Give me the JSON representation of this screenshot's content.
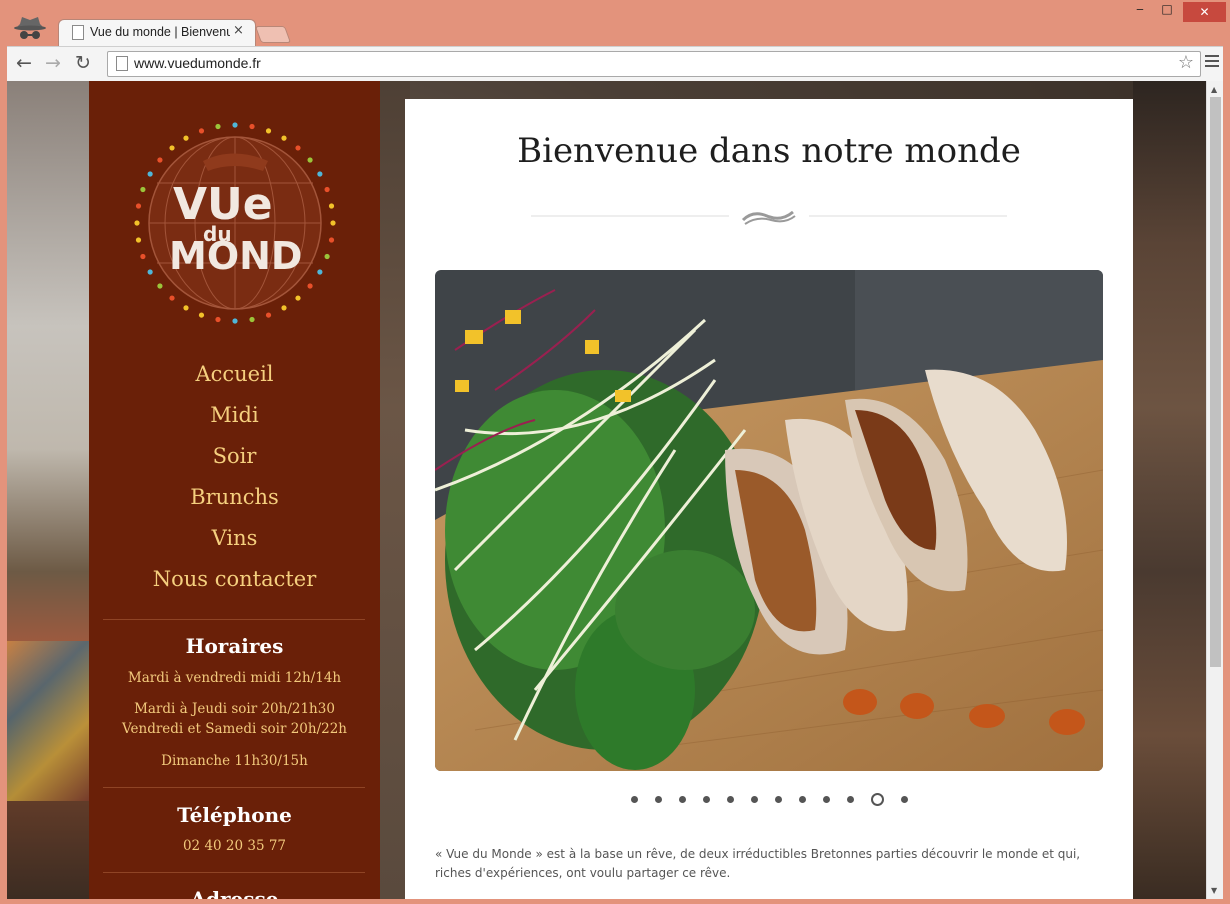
{
  "browser": {
    "tab_title": "Vue du monde | Bienvenue",
    "tab_close": "×",
    "url": "www.vuedumonde.fr",
    "window_controls": {
      "minimize": "‒",
      "maximize": "□",
      "close": "✕"
    }
  },
  "sidebar": {
    "logo": {
      "line1": "VUe",
      "line2": "du",
      "line3": "MOND"
    },
    "nav": [
      {
        "label": "Accueil"
      },
      {
        "label": "Midi"
      },
      {
        "label": "Soir"
      },
      {
        "label": "Brunchs"
      },
      {
        "label": "Vins"
      },
      {
        "label": "Nous contacter"
      }
    ],
    "hours": {
      "title": "Horaires",
      "lines": [
        "Mardi à vendredi midi 12h/14h",
        "Mardi à Jeudi soir 20h/21h30",
        "Vendredi et Samedi soir 20h/22h",
        "Dimanche 11h30/15h"
      ]
    },
    "phone": {
      "title": "Téléphone",
      "number": "02 40 20 35 77"
    },
    "address": {
      "title": "Adresse"
    }
  },
  "main": {
    "headline": "Bienvenue dans notre monde",
    "slider": {
      "count": 12,
      "active_index": 10
    },
    "intro": "« Vue du Monde » est à la base un rêve, de deux irréductibles Bretonnes parties découvrir le monde et qui, riches d'expériences, ont voulu partager ce rêve."
  },
  "colors": {
    "sidebar_bg": "#6a2008",
    "nav_text": "#f5cf7e",
    "frame": "#e3937c"
  }
}
